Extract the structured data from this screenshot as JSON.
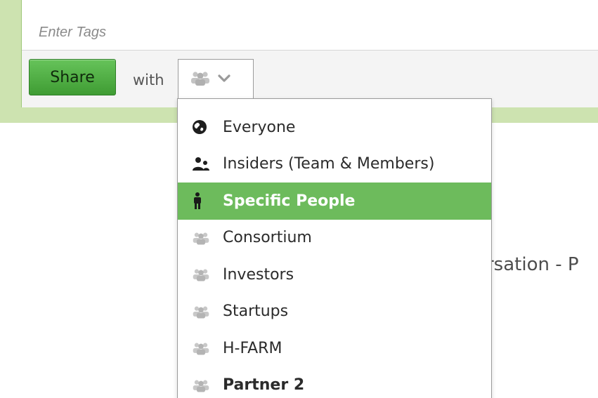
{
  "composer": {
    "tags_placeholder": "Enter Tags"
  },
  "share_bar": {
    "share_label": "Share",
    "with_label": "with",
    "audience_icon": "group-icon",
    "chevron_icon": "chevron-down-icon"
  },
  "dropdown": {
    "items": [
      {
        "label": "Everyone",
        "icon": "globe-icon"
      },
      {
        "label": "Insiders (Team & Members)",
        "icon": "users-icon"
      },
      {
        "label": "Specific People",
        "icon": "person-icon",
        "selected": true
      },
      {
        "label": "Consortium",
        "icon": "group-icon"
      },
      {
        "label": "Investors",
        "icon": "group-icon"
      },
      {
        "label": "Startups",
        "icon": "group-icon"
      },
      {
        "label": "H-FARM",
        "icon": "group-icon"
      },
      {
        "label": "Partner 2",
        "icon": "group-icon"
      }
    ]
  },
  "background": {
    "partial_text": "ersation - P"
  },
  "colors": {
    "accent_green": "#6dbb5c",
    "border_green": "#9fc87a",
    "composer_bg": "#cde3b0"
  }
}
